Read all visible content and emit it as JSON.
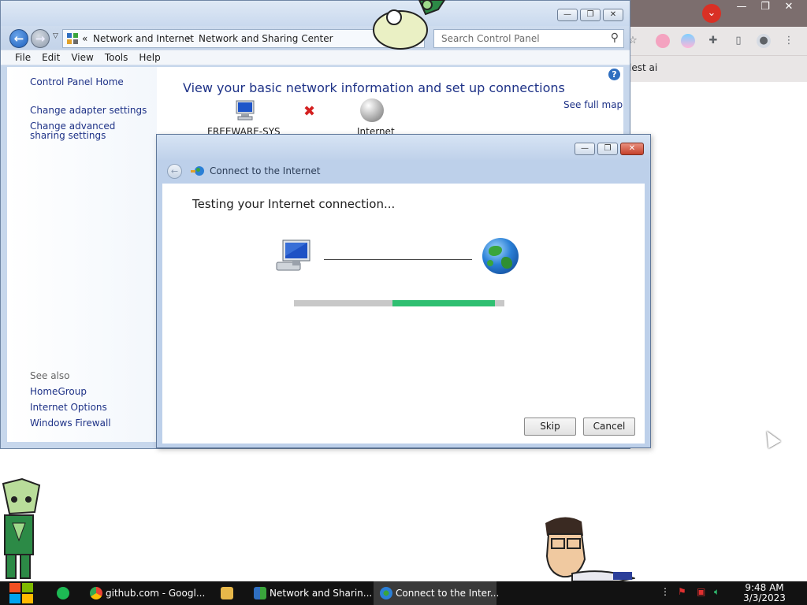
{
  "chrome": {
    "bookmark_text": "lest ai",
    "window_controls": [
      "minimize",
      "restore",
      "close"
    ]
  },
  "control_panel": {
    "breadcrumb": {
      "recent": "«",
      "items": [
        "Network and Internet",
        "Network and Sharing Center"
      ],
      "separator": "▸"
    },
    "search_placeholder": "Search Control Panel",
    "menu": [
      "File",
      "Edit",
      "View",
      "Tools",
      "Help"
    ],
    "sidebar": {
      "home": "Control Panel Home",
      "links": [
        "Change adapter settings",
        "Change advanced sharing settings"
      ],
      "see_also_label": "See also",
      "see_also": [
        "HomeGroup",
        "Internet Options",
        "Windows Firewall"
      ]
    },
    "heading": "View your basic network information and set up connections",
    "see_full_map": "See full map",
    "map": {
      "computer_label": "FREEWARE-SYS",
      "internet_label": "Internet"
    },
    "help_label": "?"
  },
  "dialog": {
    "title": "Connect to the Internet",
    "status": "Testing your Internet connection...",
    "progress": {
      "start": 0.47,
      "end": 0.955
    },
    "buttons": {
      "skip": "Skip",
      "cancel": "Cancel"
    },
    "colors": {
      "progress_fill": "#2fbf71",
      "progress_track": "#c8c8c8"
    }
  },
  "taskbar": {
    "apps": [
      {
        "label": "github.com - Googl..."
      },
      {
        "label": "Network and Sharin..."
      },
      {
        "label": "Connect to the Inter..."
      }
    ],
    "clock": {
      "time": "9:48 AM",
      "date": "3/3/2023"
    }
  }
}
